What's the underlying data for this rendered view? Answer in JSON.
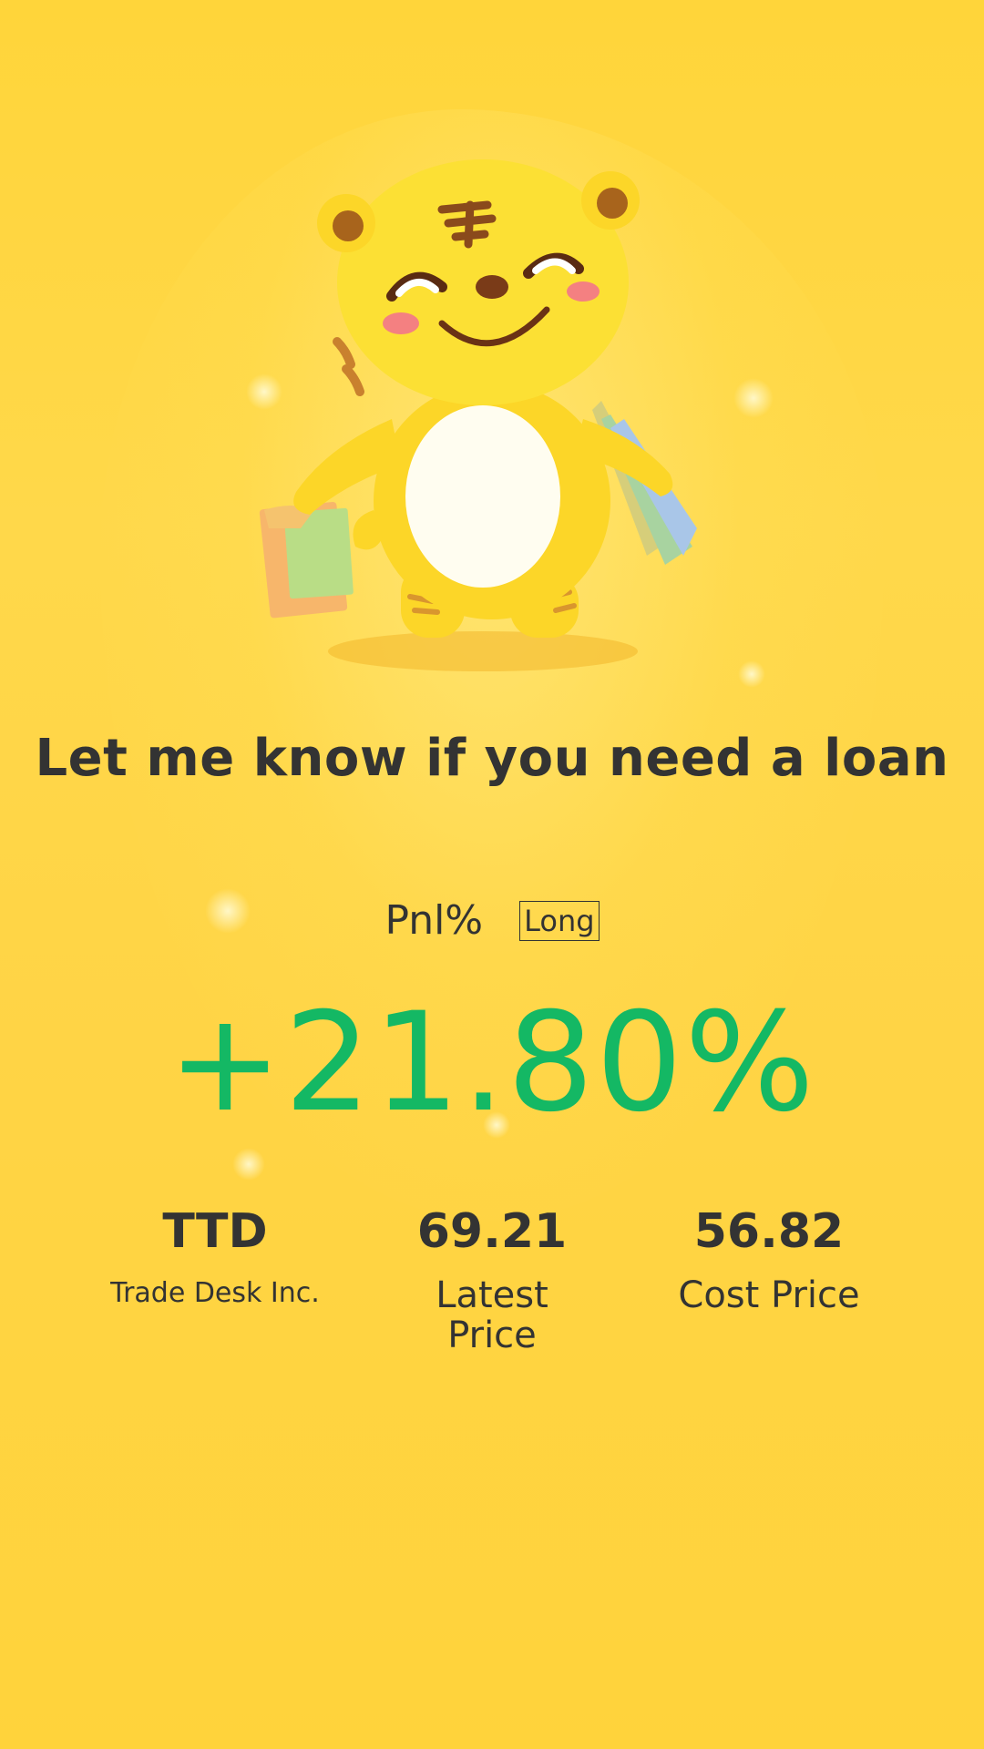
{
  "headline": "Let me know if you need a loan",
  "pnl": {
    "label": "Pnl%",
    "tag": "Long",
    "value": "+21.80%",
    "value_color": "#14b864"
  },
  "stats": [
    {
      "value": "TTD",
      "label": "Trade Desk Inc."
    },
    {
      "value": "69.21",
      "label": "Latest Price"
    },
    {
      "value": "56.82",
      "label": "Cost Price"
    }
  ],
  "mascot": {
    "icon": "tiger-mascot-icon"
  },
  "colors": {
    "background": "#ffd53a",
    "text": "#333333",
    "positive": "#14b864"
  }
}
